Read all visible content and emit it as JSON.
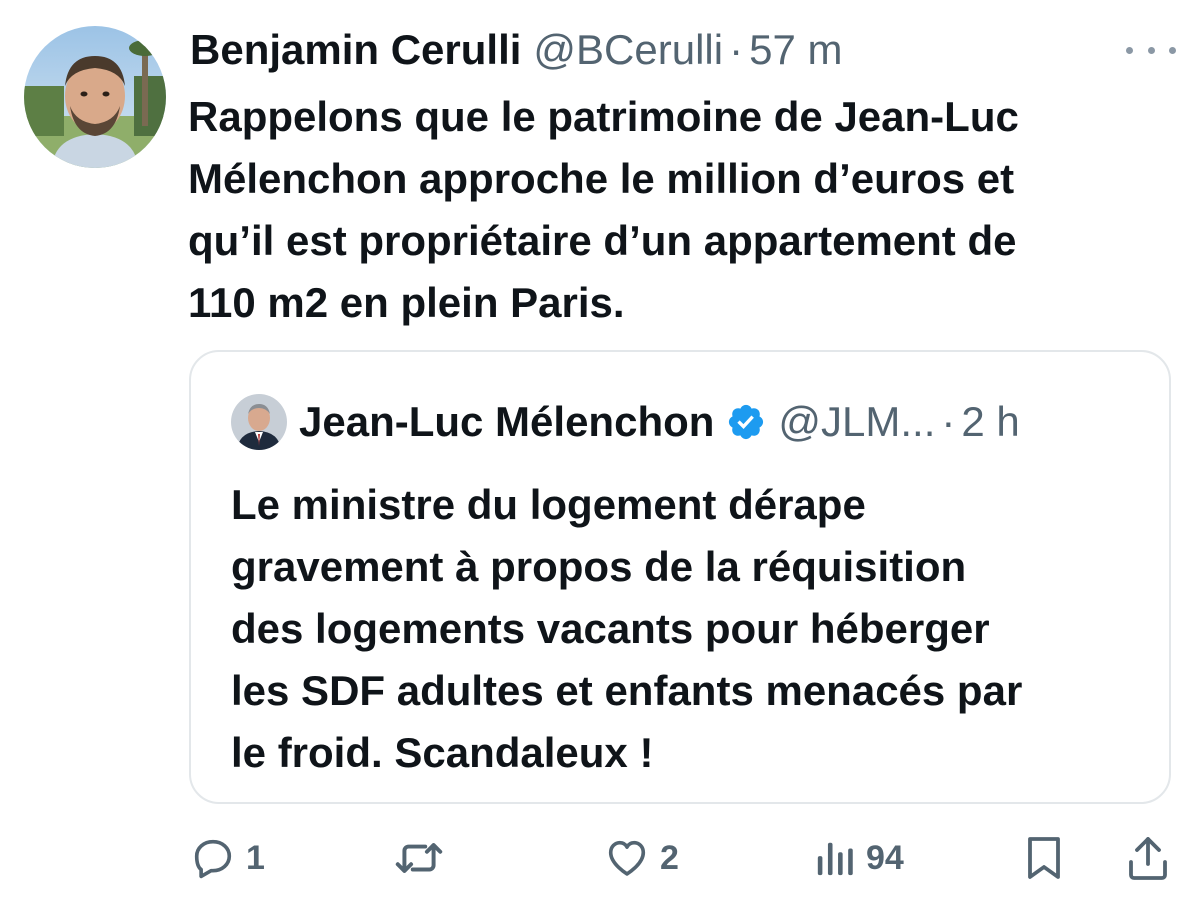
{
  "tweet": {
    "author": {
      "name": "Benjamin Cerulli",
      "handle": "@BCerulli",
      "time": "57 m",
      "separator": "·"
    },
    "text": "Rappelons que le patrimoine de Jean-Luc\nMélenchon approche le million d’euros et\nqu’il est propriétaire d’un appartement de\n110 m2 en plein Paris."
  },
  "quoted_tweet": {
    "author": {
      "name": "Jean-Luc Mélenchon",
      "handle": "@JLM...",
      "time": "2 h",
      "separator": "·",
      "verified": true
    },
    "text": "Le ministre du logement dérape\ngravement à propos de la réquisition\ndes logements vacants pour héberger\nles SDF adultes et enfants menacés par\nle froid. Scandaleux !"
  },
  "actions": {
    "replies": "1",
    "retweets": "",
    "likes": "2",
    "views": "94"
  },
  "icons": {
    "reply": "reply-icon",
    "retweet": "retweet-icon",
    "like": "heart-icon",
    "views": "views-icon",
    "bookmark": "bookmark-icon",
    "share": "share-icon",
    "more": "more-icon",
    "verified": "verified-badge-icon"
  },
  "colors": {
    "text": "#0f1419",
    "secondary": "#536471",
    "verified": "#1d9bf0",
    "border": "#e3e7ea"
  }
}
